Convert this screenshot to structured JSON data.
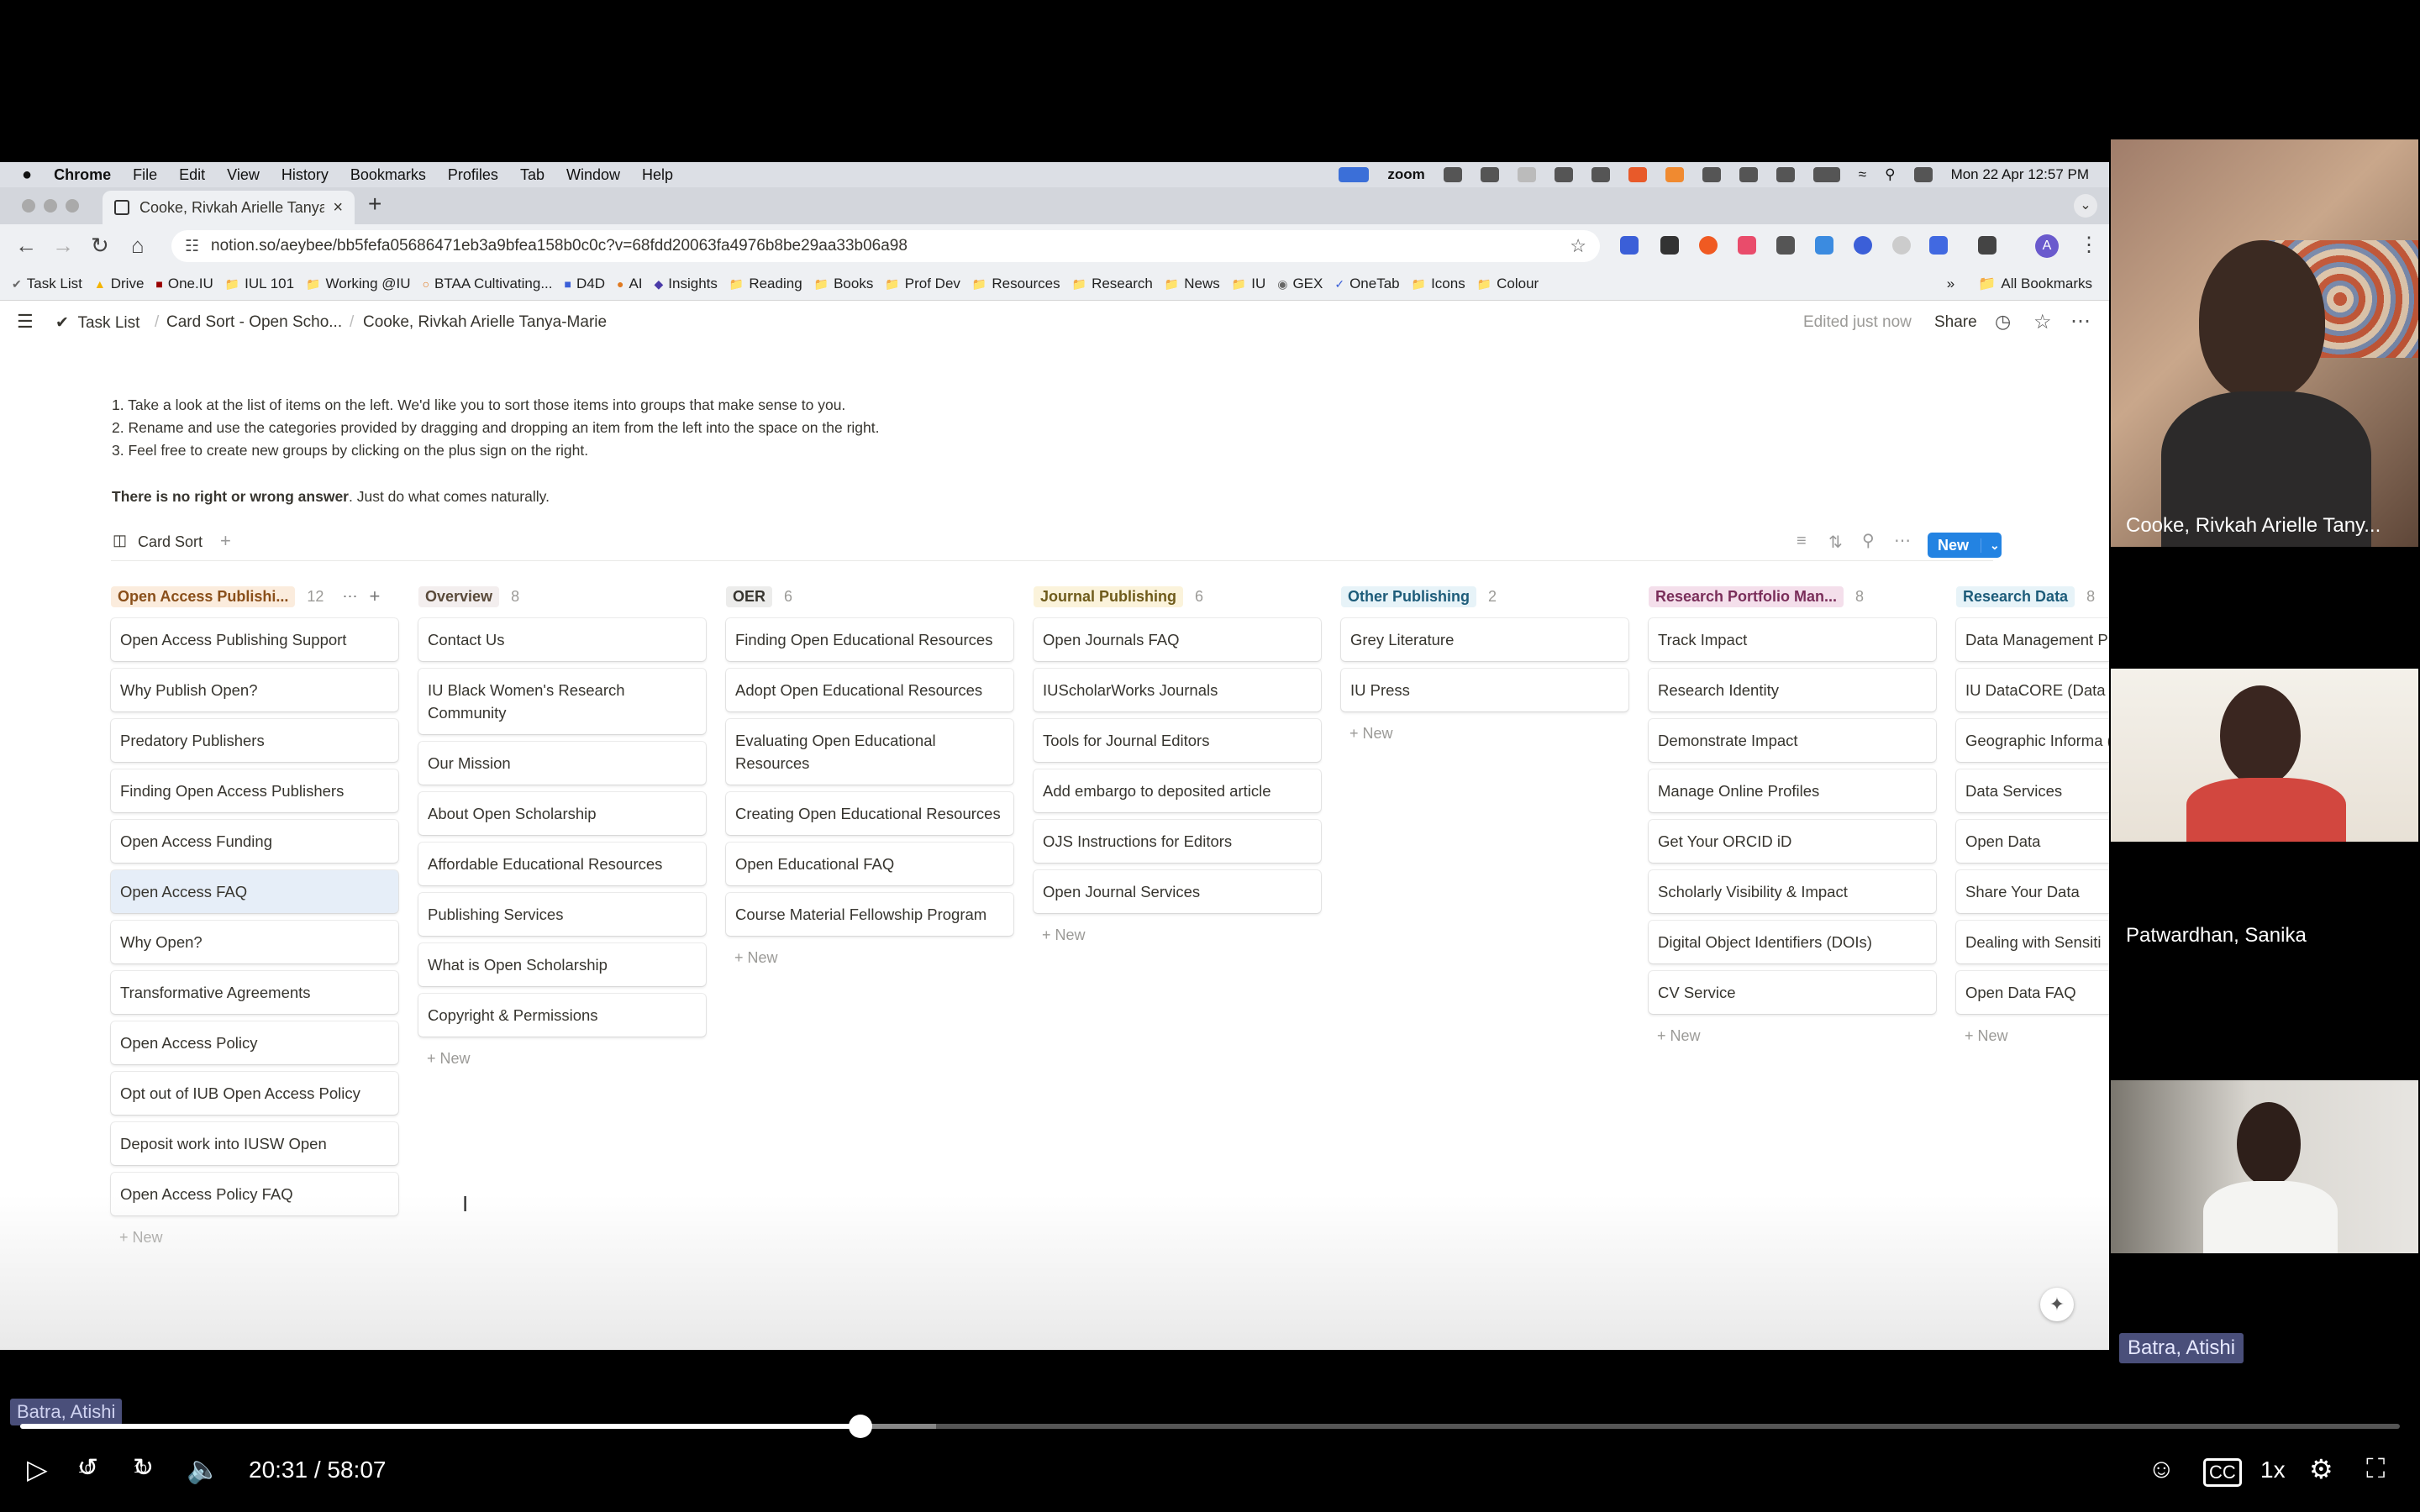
{
  "menubar": {
    "apple": "",
    "app": "Chrome",
    "items": [
      "File",
      "Edit",
      "View",
      "History",
      "Bookmarks",
      "Profiles",
      "Tab",
      "Window",
      "Help"
    ],
    "zoom": "zoom",
    "datetime": "Mon 22 Apr  12:57 PM"
  },
  "browser": {
    "tab_title": "Cooke, Rivkah Arielle Tanya-",
    "url": "notion.so/aeybee/bb5fefa05686471eb3a9bfea158b0c0c?v=68fdd20063fa4976b8be29aa33b06a98",
    "avatar": "A",
    "bookmarks": [
      "Task List",
      "Drive",
      "One.IU",
      "IUL 101",
      "Working @IU",
      "BTAA Cultivating...",
      "D4D",
      "AI",
      "Insights",
      "Reading",
      "Books",
      "Prof Dev",
      "Resources",
      "Research",
      "News",
      "IU",
      "GEX",
      "OneTab",
      "Icons",
      "Colour"
    ],
    "all_bookmarks": "All Bookmarks"
  },
  "notion": {
    "breadcrumb": [
      "Task List",
      "Card Sort - Open Scho...",
      "Cooke, Rivkah Arielle Tanya-Marie"
    ],
    "edited": "Edited just now",
    "share": "Share",
    "instructions": [
      "1. Take a look at the list of items on the left. We'd like you to sort those items into groups that make sense to you.",
      "2. Rename and use the categories provided by dragging and dropping an item from the left into the space on the right.",
      "3. Feel free to create new groups by clicking on the plus sign on the right."
    ],
    "note_bold": "There is no right or wrong answer",
    "note_rest": ". Just do what comes naturally.",
    "view_name": "Card Sort",
    "new_button": "New",
    "add_new": "New",
    "columns": [
      {
        "title": "Open Access Publishi...",
        "count": "12",
        "color": "#fbecdd",
        "text": "#8a4f1a",
        "cards": [
          "Open Access Publishing Support",
          "Why Publish Open?",
          "Predatory Publishers",
          "Finding Open Access Publishers",
          "Open Access Funding",
          "Open Access FAQ",
          "Why Open?",
          "Transformative Agreements",
          "Open Access Policy",
          "Opt out of IUB Open Access Policy",
          "Deposit work into IUSW Open",
          "Open Access Policy FAQ"
        ]
      },
      {
        "title": "Overview",
        "count": "8",
        "color": "#f3eeee",
        "text": "#5a4a3a",
        "cards": [
          "Contact Us",
          "IU Black Women's Research Community",
          "Our Mission",
          "About Open Scholarship",
          "Affordable Educational Resources",
          "Publishing Services",
          "What is Open Scholarship",
          "Copyright & Permissions"
        ]
      },
      {
        "title": "OER",
        "count": "6",
        "color": "#ececeb",
        "text": "#37352f",
        "cards": [
          "Finding Open Educational Resources",
          "Adopt Open Educational Resources",
          "Evaluating Open Educational Resources",
          "Creating Open Educational Resources",
          "Open Educational FAQ",
          "Course Material Fellowship Program"
        ]
      },
      {
        "title": "Journal Publishing",
        "count": "6",
        "color": "#fbf3db",
        "text": "#6f5b1b",
        "cards": [
          "Open Journals FAQ",
          "IUScholarWorks Journals",
          "Tools for Journal Editors",
          "Add embargo to deposited article",
          "OJS Instructions for Editors",
          "Open Journal Services"
        ]
      },
      {
        "title": "Other Publishing",
        "count": "2",
        "color": "#e7f3f8",
        "text": "#1d5c7a",
        "cards": [
          "Grey Literature",
          "IU Press"
        ]
      },
      {
        "title": "Research Portfolio Man...",
        "count": "8",
        "color": "#f4dfeb",
        "text": "#7a2e5a",
        "cards": [
          "Track Impact",
          "Research Identity",
          "Demonstrate Impact",
          "Manage Online Profiles",
          "Get Your ORCID iD",
          "Scholarly Visibility & Impact",
          "Digital Object Identifiers (DOIs)",
          "CV Service"
        ]
      },
      {
        "title": "Research Data",
        "count": "8",
        "color": "#e7f3f8",
        "text": "#1d5c7a",
        "cards": [
          "Data Management P",
          "IU DataCORE (Data",
          "Geographic Informa (GIS) Services",
          "Data Services",
          "Open Data",
          "Share Your Data",
          "Dealing with Sensiti",
          "Open Data FAQ"
        ]
      }
    ]
  },
  "participants": [
    {
      "name": "Cooke, Rivkah Arielle Tany..."
    },
    {
      "name": "Patwardhan, Sanika"
    },
    {
      "name": "Batra, Atishi"
    }
  ],
  "player": {
    "speaker": "Batra, Atishi",
    "time": "20:31 / 58:07",
    "progress": 0.353,
    "speed": "1x",
    "skip": "10"
  }
}
